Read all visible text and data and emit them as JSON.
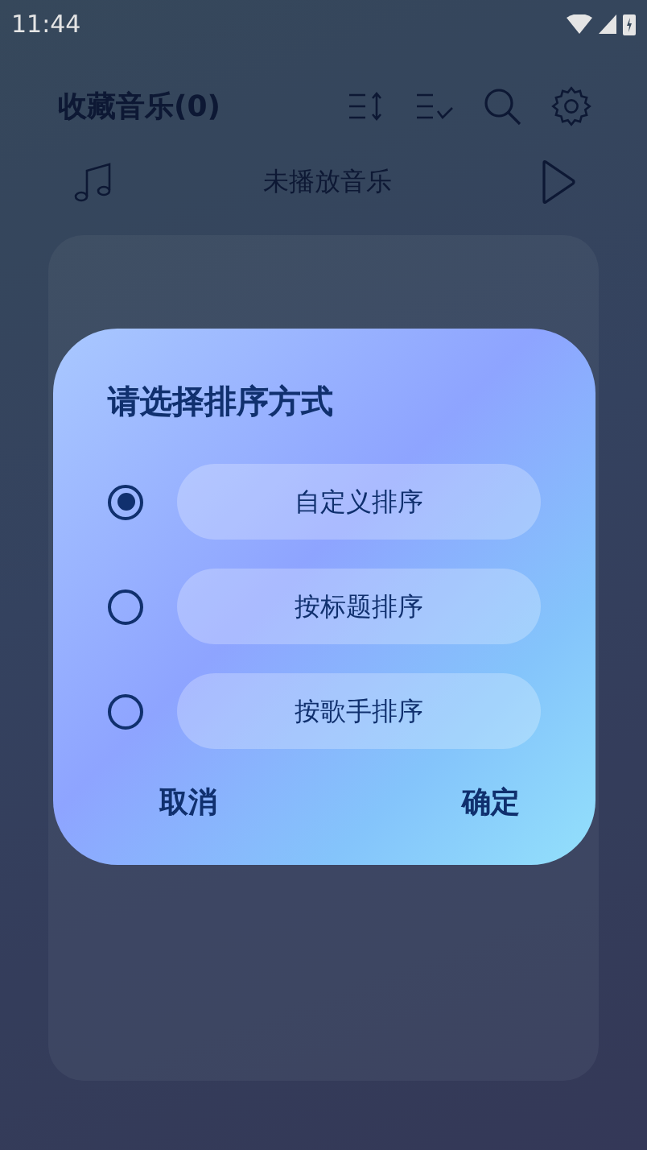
{
  "status_bar": {
    "time": "11:44"
  },
  "header": {
    "title": "收藏音乐(0)"
  },
  "player": {
    "now_playing": "未播放音乐"
  },
  "dialog": {
    "title": "请选择排序方式",
    "options": [
      {
        "label": "自定义排序",
        "selected": true
      },
      {
        "label": "按标题排序",
        "selected": false
      },
      {
        "label": "按歌手排序",
        "selected": false
      }
    ],
    "buttons": [
      "取消",
      "确定"
    ]
  }
}
